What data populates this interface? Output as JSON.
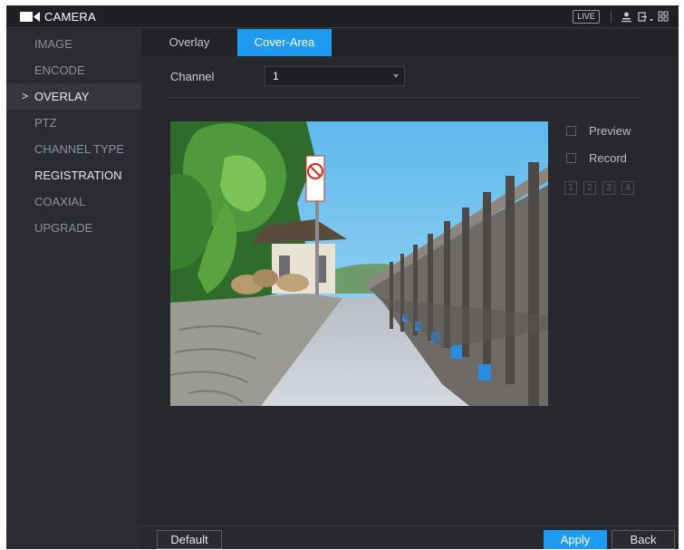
{
  "titlebar": {
    "title": "CAMERA",
    "live_label": "LIVE",
    "icons": [
      "camera-icon",
      "user-icon",
      "logout-icon",
      "menu-grid-icon"
    ]
  },
  "sidebar": {
    "items": [
      {
        "label": "IMAGE"
      },
      {
        "label": "ENCODE"
      },
      {
        "label": "OVERLAY",
        "active": true,
        "marker": ">"
      },
      {
        "label": "PTZ"
      },
      {
        "label": "CHANNEL TYPE"
      },
      {
        "label": "REGISTRATION"
      },
      {
        "label": "COAXIAL UPGRADE"
      }
    ]
  },
  "tabs": [
    {
      "label": "Overlay"
    },
    {
      "label": "Cover-Area",
      "active": true
    }
  ],
  "channel": {
    "label": "Channel",
    "value": "1"
  },
  "options": {
    "preview_label": "Preview",
    "record_label": "Record",
    "areas": [
      "1",
      "2",
      "3",
      "4"
    ]
  },
  "footer": {
    "default_label": "Default",
    "apply_label": "Apply",
    "back_label": "Back"
  },
  "colors": {
    "accent": "#1e9bf0",
    "background": "#28292e",
    "sidebar": "#2b2c31"
  }
}
